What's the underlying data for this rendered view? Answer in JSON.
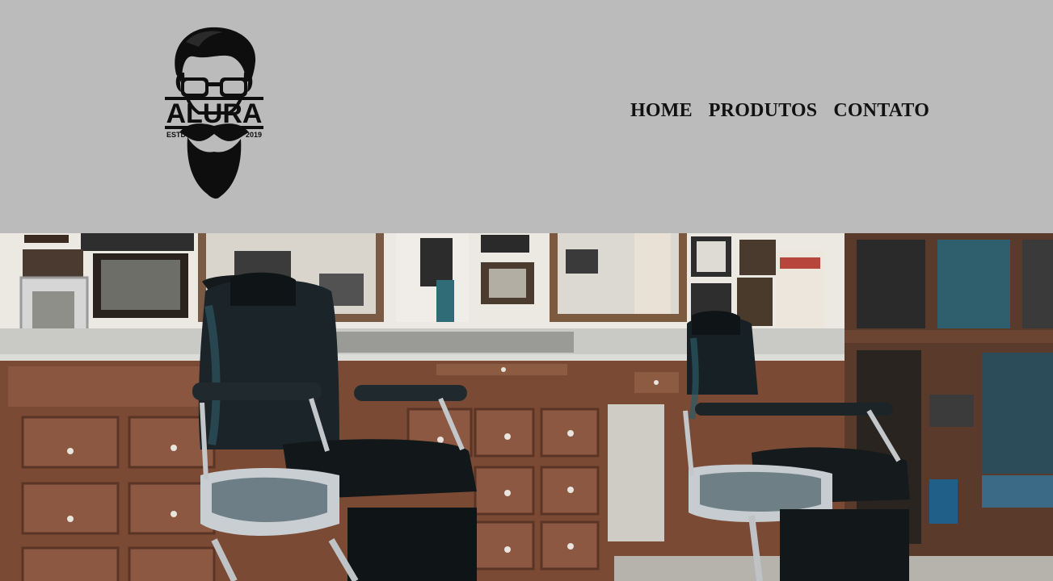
{
  "brand": {
    "logo_icon": "bearded-man-glasses-logo",
    "logo_text": "ALURA",
    "established_label": "ESTD",
    "established_year": "2019"
  },
  "nav": {
    "items": [
      {
        "label": "HOME"
      },
      {
        "label": "PRODUTOS"
      },
      {
        "label": "CONTATO"
      }
    ]
  },
  "hero": {
    "image_icon": "barbershop-photo"
  },
  "colors": {
    "header_bg": "#bbbbbb",
    "nav_text": "#111111"
  }
}
